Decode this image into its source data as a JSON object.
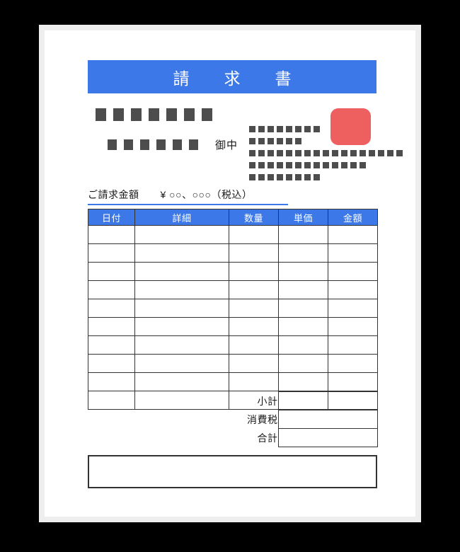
{
  "document": {
    "title_banner": "請　求　書",
    "onchu": "御中",
    "amount_label": "ご請求金額",
    "amount_value": "¥ ○○、○○○（税込）"
  },
  "addressee_placeholder": {
    "row1_blocks": 7,
    "row2_blocks": 6
  },
  "issuer_placeholder": {
    "row1_blocks": 8,
    "row2_blocks": 6,
    "row3_blocks": 17,
    "row4_blocks": 13,
    "row5_blocks": 8
  },
  "seal": {
    "color": "#ee6060"
  },
  "items_table": {
    "headers": [
      "日付",
      "詳細",
      "数量",
      "単価",
      "金額"
    ],
    "row_count": 10,
    "rows": [
      [
        "",
        "",
        "",
        "",
        ""
      ],
      [
        "",
        "",
        "",
        "",
        ""
      ],
      [
        "",
        "",
        "",
        "",
        ""
      ],
      [
        "",
        "",
        "",
        "",
        ""
      ],
      [
        "",
        "",
        "",
        "",
        ""
      ],
      [
        "",
        "",
        "",
        "",
        ""
      ],
      [
        "",
        "",
        "",
        "",
        ""
      ],
      [
        "",
        "",
        "",
        "",
        ""
      ],
      [
        "",
        "",
        "",
        "",
        ""
      ],
      [
        "",
        "",
        "",
        "",
        ""
      ]
    ]
  },
  "totals": [
    {
      "label": "小計",
      "value": ""
    },
    {
      "label": "消費税",
      "value": ""
    },
    {
      "label": "合計",
      "value": ""
    }
  ],
  "notes": {
    "value": ""
  },
  "colors": {
    "accent_blue": "#3d78e8",
    "seal_red": "#ee6060",
    "border_dark": "#333333",
    "block_gray": "#4d4d4d",
    "page_border": "#eeeeee",
    "backdrop": "#000000"
  }
}
